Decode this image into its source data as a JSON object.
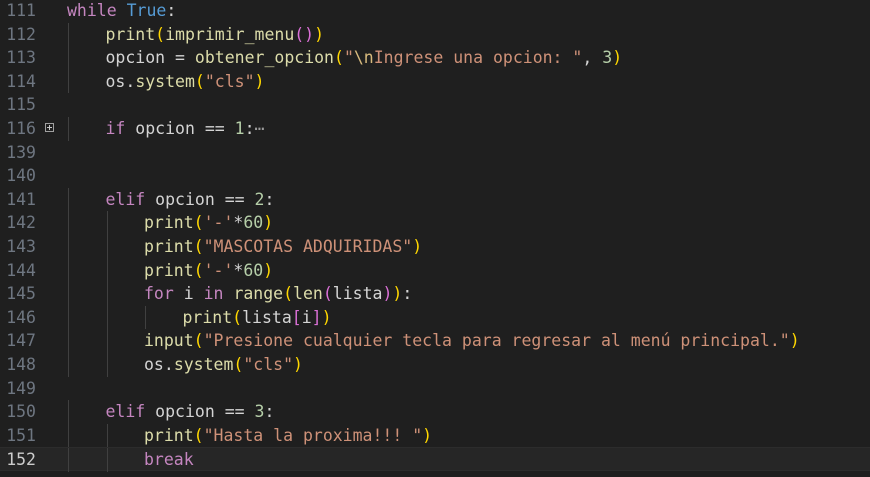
{
  "editor": {
    "language": "python",
    "current_line": "152",
    "lines": [
      {
        "num": "111",
        "indent": 0,
        "tokens": [
          [
            "kw",
            "while"
          ],
          [
            "t",
            " "
          ],
          [
            "cst",
            "True"
          ],
          [
            "op",
            ":"
          ]
        ]
      },
      {
        "num": "112",
        "indent": 1,
        "tokens": [
          [
            "bi",
            "print"
          ],
          [
            "p1",
            "("
          ],
          [
            "fn",
            "imprimir_menu"
          ],
          [
            "p2",
            "()"
          ],
          [
            "p1",
            ")"
          ]
        ]
      },
      {
        "num": "113",
        "indent": 1,
        "tokens": [
          [
            "t",
            "opcion "
          ],
          [
            "op",
            "="
          ],
          [
            "t",
            " "
          ],
          [
            "fn",
            "obtener_opcion"
          ],
          [
            "p1",
            "("
          ],
          [
            "str",
            "\""
          ],
          [
            "esc",
            "\\n"
          ],
          [
            "str",
            "Ingrese una opcion: \""
          ],
          [
            "t",
            ", "
          ],
          [
            "num",
            "3"
          ],
          [
            "p1",
            ")"
          ]
        ]
      },
      {
        "num": "114",
        "indent": 1,
        "tokens": [
          [
            "t",
            "os."
          ],
          [
            "fn",
            "system"
          ],
          [
            "p1",
            "("
          ],
          [
            "str",
            "\"cls\""
          ],
          [
            "p1",
            ")"
          ]
        ]
      },
      {
        "num": "115",
        "indent": 0,
        "tokens": []
      },
      {
        "num": "116",
        "indent": 1,
        "fold": "collapsed",
        "tokens": [
          [
            "kw",
            "if"
          ],
          [
            "t",
            " opcion "
          ],
          [
            "op",
            "=="
          ],
          [
            "t",
            " "
          ],
          [
            "num",
            "1"
          ],
          [
            "op",
            ":"
          ],
          [
            "ell",
            "⋯"
          ]
        ]
      },
      {
        "num": "139",
        "indent": 0,
        "tokens": []
      },
      {
        "num": "140",
        "indent": 0,
        "tokens": []
      },
      {
        "num": "141",
        "indent": 1,
        "tokens": [
          [
            "kw",
            "elif"
          ],
          [
            "t",
            " opcion "
          ],
          [
            "op",
            "=="
          ],
          [
            "t",
            " "
          ],
          [
            "num",
            "2"
          ],
          [
            "op",
            ":"
          ]
        ]
      },
      {
        "num": "142",
        "indent": 2,
        "tokens": [
          [
            "bi",
            "print"
          ],
          [
            "p1",
            "("
          ],
          [
            "str",
            "'-'"
          ],
          [
            "op",
            "*"
          ],
          [
            "num",
            "60"
          ],
          [
            "p1",
            ")"
          ]
        ]
      },
      {
        "num": "143",
        "indent": 2,
        "tokens": [
          [
            "bi",
            "print"
          ],
          [
            "p1",
            "("
          ],
          [
            "str",
            "\"MASCOTAS ADQUIRIDAS\""
          ],
          [
            "p1",
            ")"
          ]
        ]
      },
      {
        "num": "144",
        "indent": 2,
        "tokens": [
          [
            "bi",
            "print"
          ],
          [
            "p1",
            "("
          ],
          [
            "str",
            "'-'"
          ],
          [
            "op",
            "*"
          ],
          [
            "num",
            "60"
          ],
          [
            "p1",
            ")"
          ]
        ]
      },
      {
        "num": "145",
        "indent": 2,
        "tokens": [
          [
            "kw",
            "for"
          ],
          [
            "t",
            " i "
          ],
          [
            "kw",
            "in"
          ],
          [
            "t",
            " "
          ],
          [
            "bi",
            "range"
          ],
          [
            "p1",
            "("
          ],
          [
            "bi",
            "len"
          ],
          [
            "p2",
            "("
          ],
          [
            "t",
            "lista"
          ],
          [
            "p2",
            ")"
          ],
          [
            "p1",
            ")"
          ],
          [
            "op",
            ":"
          ]
        ]
      },
      {
        "num": "146",
        "indent": 3,
        "tokens": [
          [
            "bi",
            "print"
          ],
          [
            "p1",
            "("
          ],
          [
            "t",
            "lista"
          ],
          [
            "p2",
            "["
          ],
          [
            "t",
            "i"
          ],
          [
            "p2",
            "]"
          ],
          [
            "p1",
            ")"
          ]
        ]
      },
      {
        "num": "147",
        "indent": 2,
        "tokens": [
          [
            "bi",
            "input"
          ],
          [
            "p1",
            "("
          ],
          [
            "str",
            "\"Presione cualquier tecla para regresar al menú principal.\""
          ],
          [
            "p1",
            ")"
          ]
        ]
      },
      {
        "num": "148",
        "indent": 2,
        "tokens": [
          [
            "t",
            "os."
          ],
          [
            "fn",
            "system"
          ],
          [
            "p1",
            "("
          ],
          [
            "str",
            "\"cls\""
          ],
          [
            "p1",
            ")"
          ]
        ]
      },
      {
        "num": "149",
        "indent": 0,
        "tokens": []
      },
      {
        "num": "150",
        "indent": 1,
        "tokens": [
          [
            "kw",
            "elif"
          ],
          [
            "t",
            " opcion "
          ],
          [
            "op",
            "=="
          ],
          [
            "t",
            " "
          ],
          [
            "num",
            "3"
          ],
          [
            "op",
            ":"
          ]
        ]
      },
      {
        "num": "151",
        "indent": 2,
        "tokens": [
          [
            "bi",
            "print"
          ],
          [
            "p1",
            "("
          ],
          [
            "str",
            "\"Hasta la proxima!!! \""
          ],
          [
            "p1",
            ")"
          ]
        ]
      },
      {
        "num": "152",
        "indent": 2,
        "tokens": [
          [
            "kw",
            "break"
          ]
        ]
      }
    ]
  },
  "colors": {
    "background": "#1f1f1f",
    "current_line": "#262626",
    "keyword": "#c586c0",
    "function": "#dcdcaa",
    "string": "#ce9178",
    "number": "#b5cea8",
    "constant": "#569cd6"
  }
}
